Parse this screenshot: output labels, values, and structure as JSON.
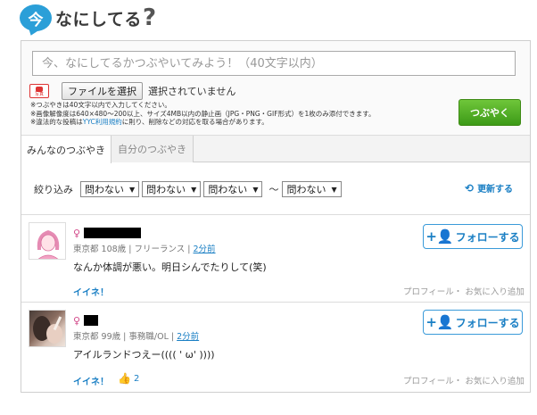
{
  "header": {
    "logo_badge": "今",
    "logo_text": "なにしてる",
    "logo_mark": "?"
  },
  "compose": {
    "placeholder": "今、なにしてるかつぶやいてみよう！（40文字以内）",
    "file_button": "ファイルを選択",
    "file_status": "選択されていません",
    "photo_icon_label": "写真",
    "notes": [
      "※つぶやきは40文字以内で入力してください。",
      "※画像解像度は640×480～200以上、サイズ4MB以内の静止画（JPG・PNG・GIF形式）を1枚のみ添付できます。"
    ],
    "note3_prefix": "※違法的な投稿は",
    "note3_link": "YYC利用規約",
    "note3_suffix": "に則り、削除などの対応を取る場合があります。",
    "submit": "つぶやく"
  },
  "tabs": [
    {
      "label": "みんなのつぶやき",
      "active": true
    },
    {
      "label": "自分のつぶやき",
      "active": false
    }
  ],
  "filter": {
    "label": "絞り込み",
    "selects": [
      "問わない",
      "問わない",
      "問わない",
      "問わない"
    ],
    "tilde": "～",
    "refresh": "更新する"
  },
  "entries": [
    {
      "gender": "♀",
      "location": "東京都",
      "age": "108歳",
      "job": "フリーランス",
      "time": "2分前",
      "text": "なんか体調が悪い。明日シんでたりして(笑)",
      "like": "イイネ！",
      "like_count": "",
      "links": "プロフィール・ お気に入り追加",
      "follow": "フォローする"
    },
    {
      "gender": "♀",
      "location": "東京都",
      "age": "99歳",
      "job": "事務職/OL",
      "time": "2分前",
      "text": "アイルランドつえー(((( ' ω' ))))",
      "like": "イイネ！",
      "like_count": "2",
      "links": "プロフィール・ お気に入り追加",
      "follow": "フォローする"
    }
  ],
  "colors": {
    "accent": "#1a7fc4",
    "submit_green": "#3c9a17",
    "logo_blue": "#2b9fd8"
  }
}
